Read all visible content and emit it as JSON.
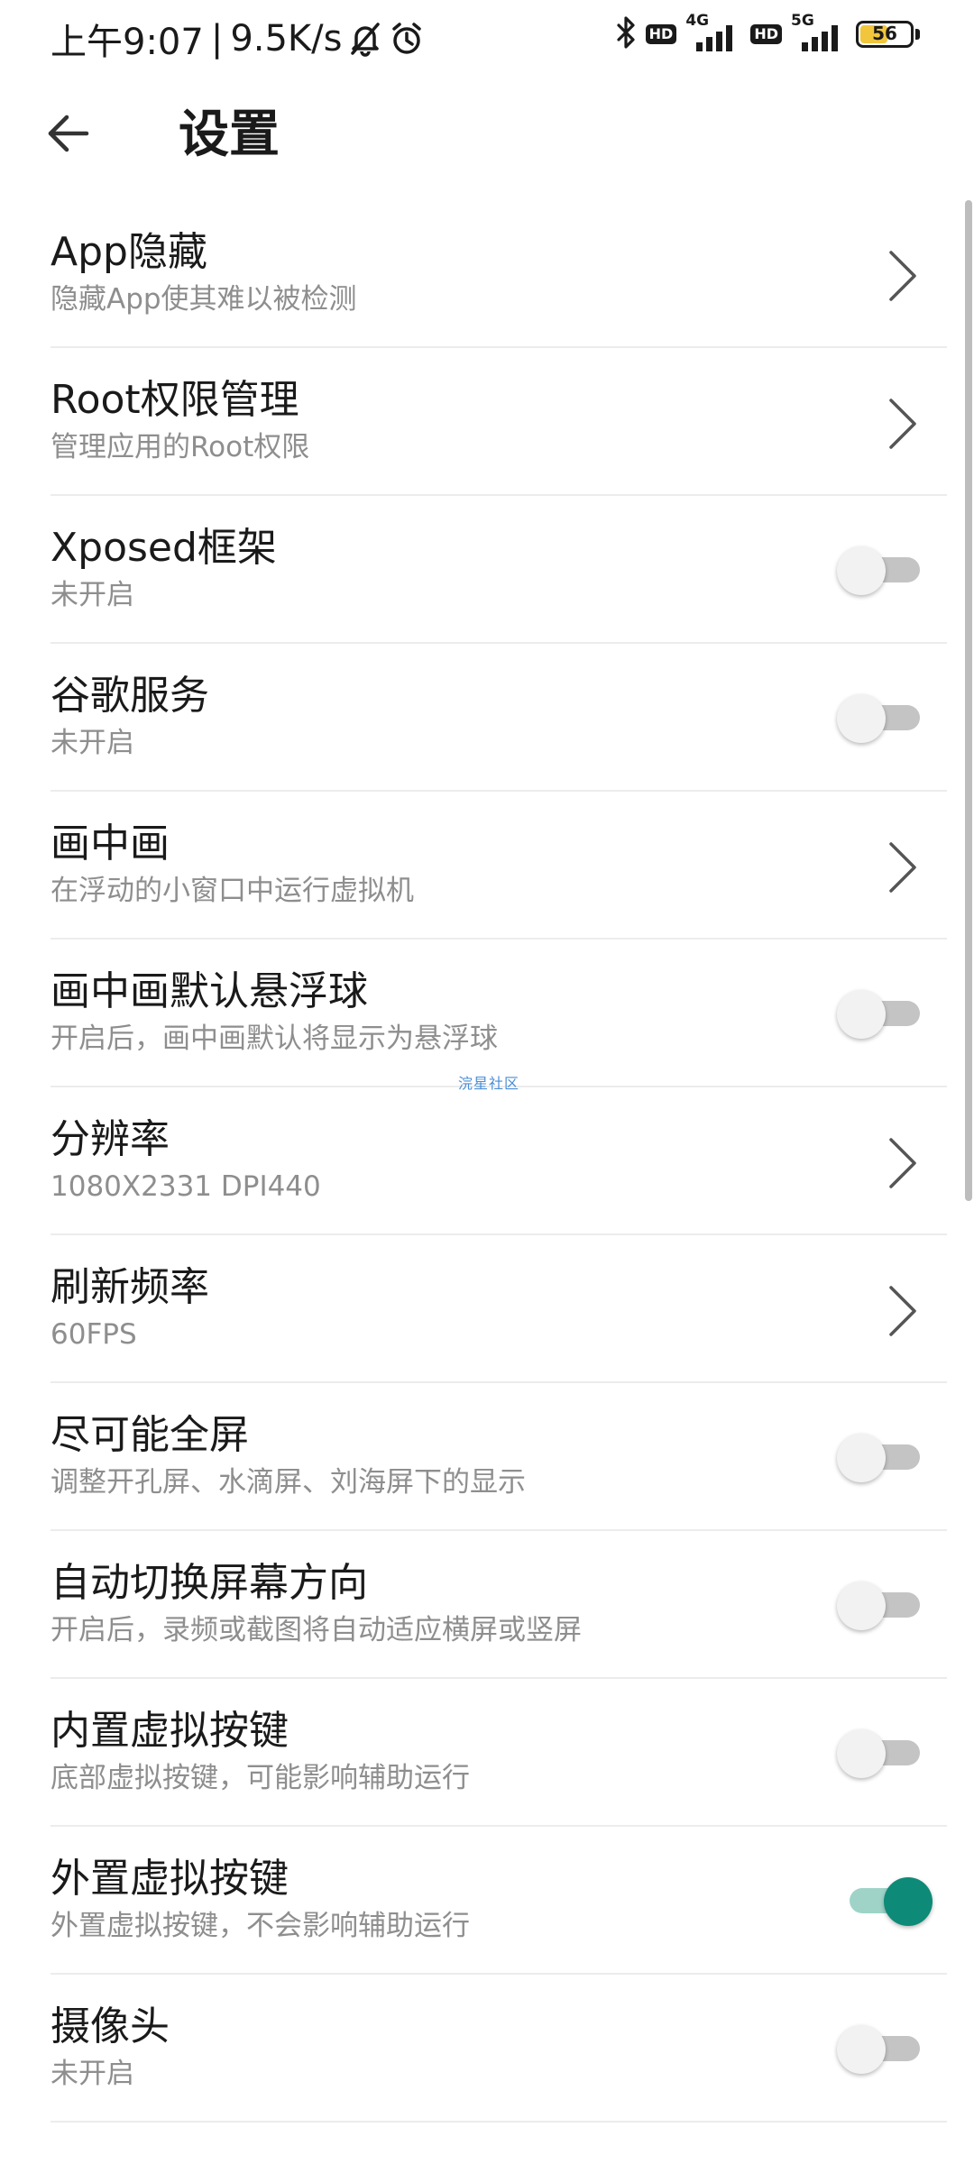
{
  "status_bar": {
    "time": "上午9:07",
    "net_speed": "9.5K/s",
    "separator": "|",
    "hd1": "HD",
    "net1": "4G",
    "hd2": "HD",
    "net2": "5G",
    "battery_level": "56",
    "battery_fraction": 0.56,
    "battery_color": "#f2c63c",
    "icons": [
      "bell-off-icon",
      "alarm-icon",
      "bluetooth-icon",
      "signal-icon",
      "battery-icon"
    ]
  },
  "header": {
    "title": "设置",
    "back_icon": "arrow-left-icon"
  },
  "watermark": "浣星社区",
  "accent_color": "#0e8a78",
  "items": [
    {
      "title": "App隐藏",
      "subtitle": "隐藏App使其难以被检测",
      "control": "chevron"
    },
    {
      "title": "Root权限管理",
      "subtitle": "管理应用的Root权限",
      "control": "chevron"
    },
    {
      "title": "Xposed框架",
      "subtitle": "未开启",
      "control": "toggle",
      "on": false
    },
    {
      "title": "谷歌服务",
      "subtitle": "未开启",
      "control": "toggle",
      "on": false
    },
    {
      "title": "画中画",
      "subtitle": "在浮动的小窗口中运行虚拟机",
      "control": "chevron"
    },
    {
      "title": "画中画默认悬浮球",
      "subtitle": "开启后，画中画默认将显示为悬浮球",
      "control": "toggle",
      "on": false
    },
    {
      "title": "分辨率",
      "subtitle": "1080X2331 DPI440",
      "control": "chevron"
    },
    {
      "title": "刷新频率",
      "subtitle": "60FPS",
      "control": "chevron"
    },
    {
      "title": "尽可能全屏",
      "subtitle": "调整开孔屏、水滴屏、刘海屏下的显示",
      "control": "toggle",
      "on": false
    },
    {
      "title": "自动切换屏幕方向",
      "subtitle": "开启后，录频或截图将自动适应横屏或竖屏",
      "control": "toggle",
      "on": false
    },
    {
      "title": "内置虚拟按键",
      "subtitle": "底部虚拟按键，可能影响辅助运行",
      "control": "toggle",
      "on": false
    },
    {
      "title": "外置虚拟按键",
      "subtitle": "外置虚拟按键，不会影响辅助运行",
      "control": "toggle",
      "on": true
    },
    {
      "title": "摄像头",
      "subtitle": "未开启",
      "control": "toggle",
      "on": false
    }
  ]
}
